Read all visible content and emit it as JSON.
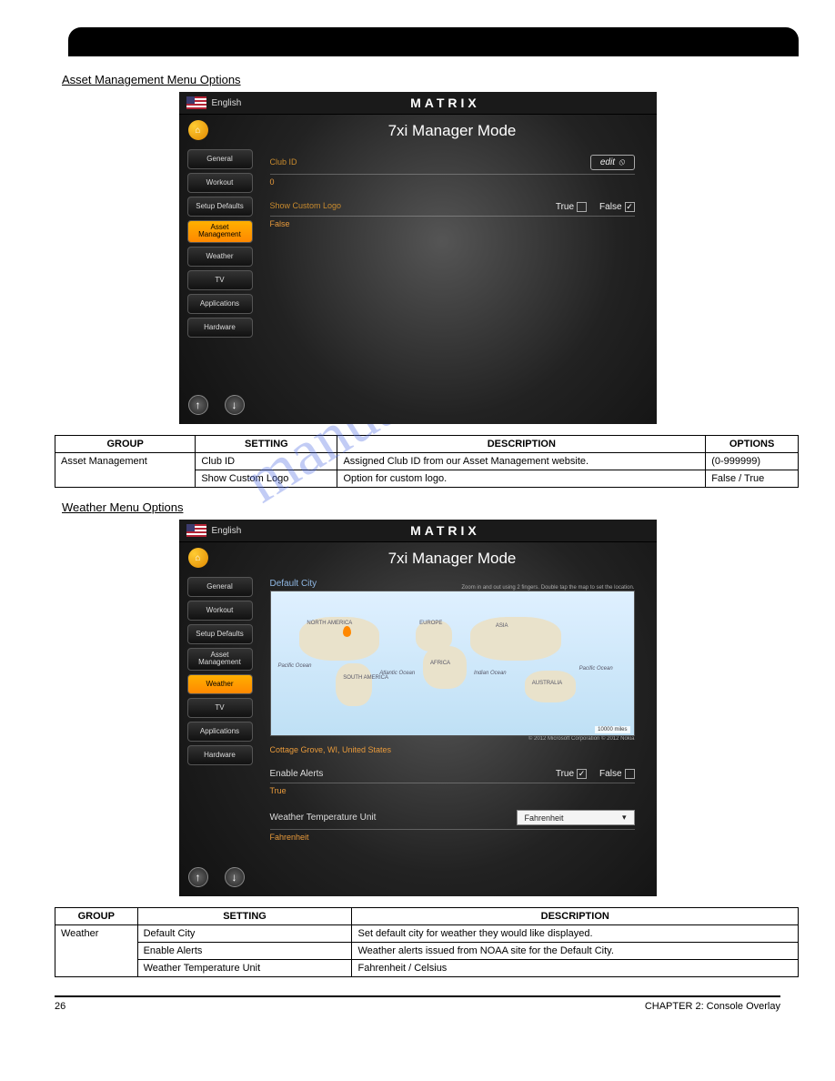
{
  "section_a": {
    "heading": "Asset Management Menu Options",
    "header": {
      "language": "English",
      "brand": "MATRIX",
      "mode_title": "7xi Manager Mode"
    },
    "nav": [
      "General",
      "Workout",
      "Setup Defaults",
      "Asset Management",
      "Weather",
      "TV",
      "Applications",
      "Hardware"
    ],
    "active_nav": "Asset Management",
    "fields": {
      "club_id_label": "Club ID",
      "club_id_value": "0",
      "edit_label": "edit",
      "show_logo_label": "Show Custom Logo",
      "true_label": "True",
      "false_label": "False",
      "show_logo_value": "False"
    },
    "table": {
      "headers": [
        "GROUP",
        "SETTING",
        "DESCRIPTION",
        "OPTIONS"
      ],
      "rows": [
        [
          "Asset Management",
          "Club ID",
          "Assigned Club ID from our Asset Management website.",
          "(0-999999)"
        ],
        [
          "",
          "Show Custom Logo",
          "Option for custom logo.",
          "False / True"
        ]
      ]
    }
  },
  "section_b": {
    "heading": "Weather Menu Options",
    "header": {
      "language": "English",
      "brand": "MATRIX",
      "mode_title": "7xi Manager Mode"
    },
    "nav": [
      "General",
      "Workout",
      "Setup Defaults",
      "Asset Management",
      "Weather",
      "TV",
      "Applications",
      "Hardware"
    ],
    "active_nav": "Weather",
    "fields": {
      "default_city_label": "Default City",
      "map_help": "Zoom in and out using 2 fingers. Double tap the map to set the location.",
      "map_labels": [
        "NORTH AMERICA",
        "EUROPE",
        "ASIA",
        "AFRICA",
        "SOUTH AMERICA",
        "AUSTRALIA",
        "Pacific Ocean",
        "Atlantic Ocean",
        "Indian Ocean",
        "Pacific Ocean"
      ],
      "map_scale": "10000 miles",
      "map_credit": "© 2012 Microsoft Corporation   © 2012 Nokia",
      "default_city_value": "Cottage Grove, WI, United States",
      "enable_alerts_label": "Enable Alerts",
      "true_label": "True",
      "false_label": "False",
      "enable_alerts_value": "True",
      "temp_unit_label": "Weather Temperature Unit",
      "temp_unit_select": "Fahrenheit",
      "temp_unit_value": "Fahrenheit"
    },
    "table": {
      "headers": [
        "GROUP",
        "SETTING",
        "DESCRIPTION"
      ],
      "rows": [
        [
          "Weather",
          "Default City",
          "Set default city for weather they would like displayed."
        ],
        [
          "",
          "Enable Alerts",
          "Weather alerts issued from NOAA site for the Default City."
        ],
        [
          "",
          "Weather Temperature Unit",
          "Fahrenheit / Celsius"
        ]
      ]
    }
  },
  "footer": {
    "left": "26",
    "right": "CHAPTER 2: Console Overlay"
  },
  "watermark": "manualshive.com"
}
